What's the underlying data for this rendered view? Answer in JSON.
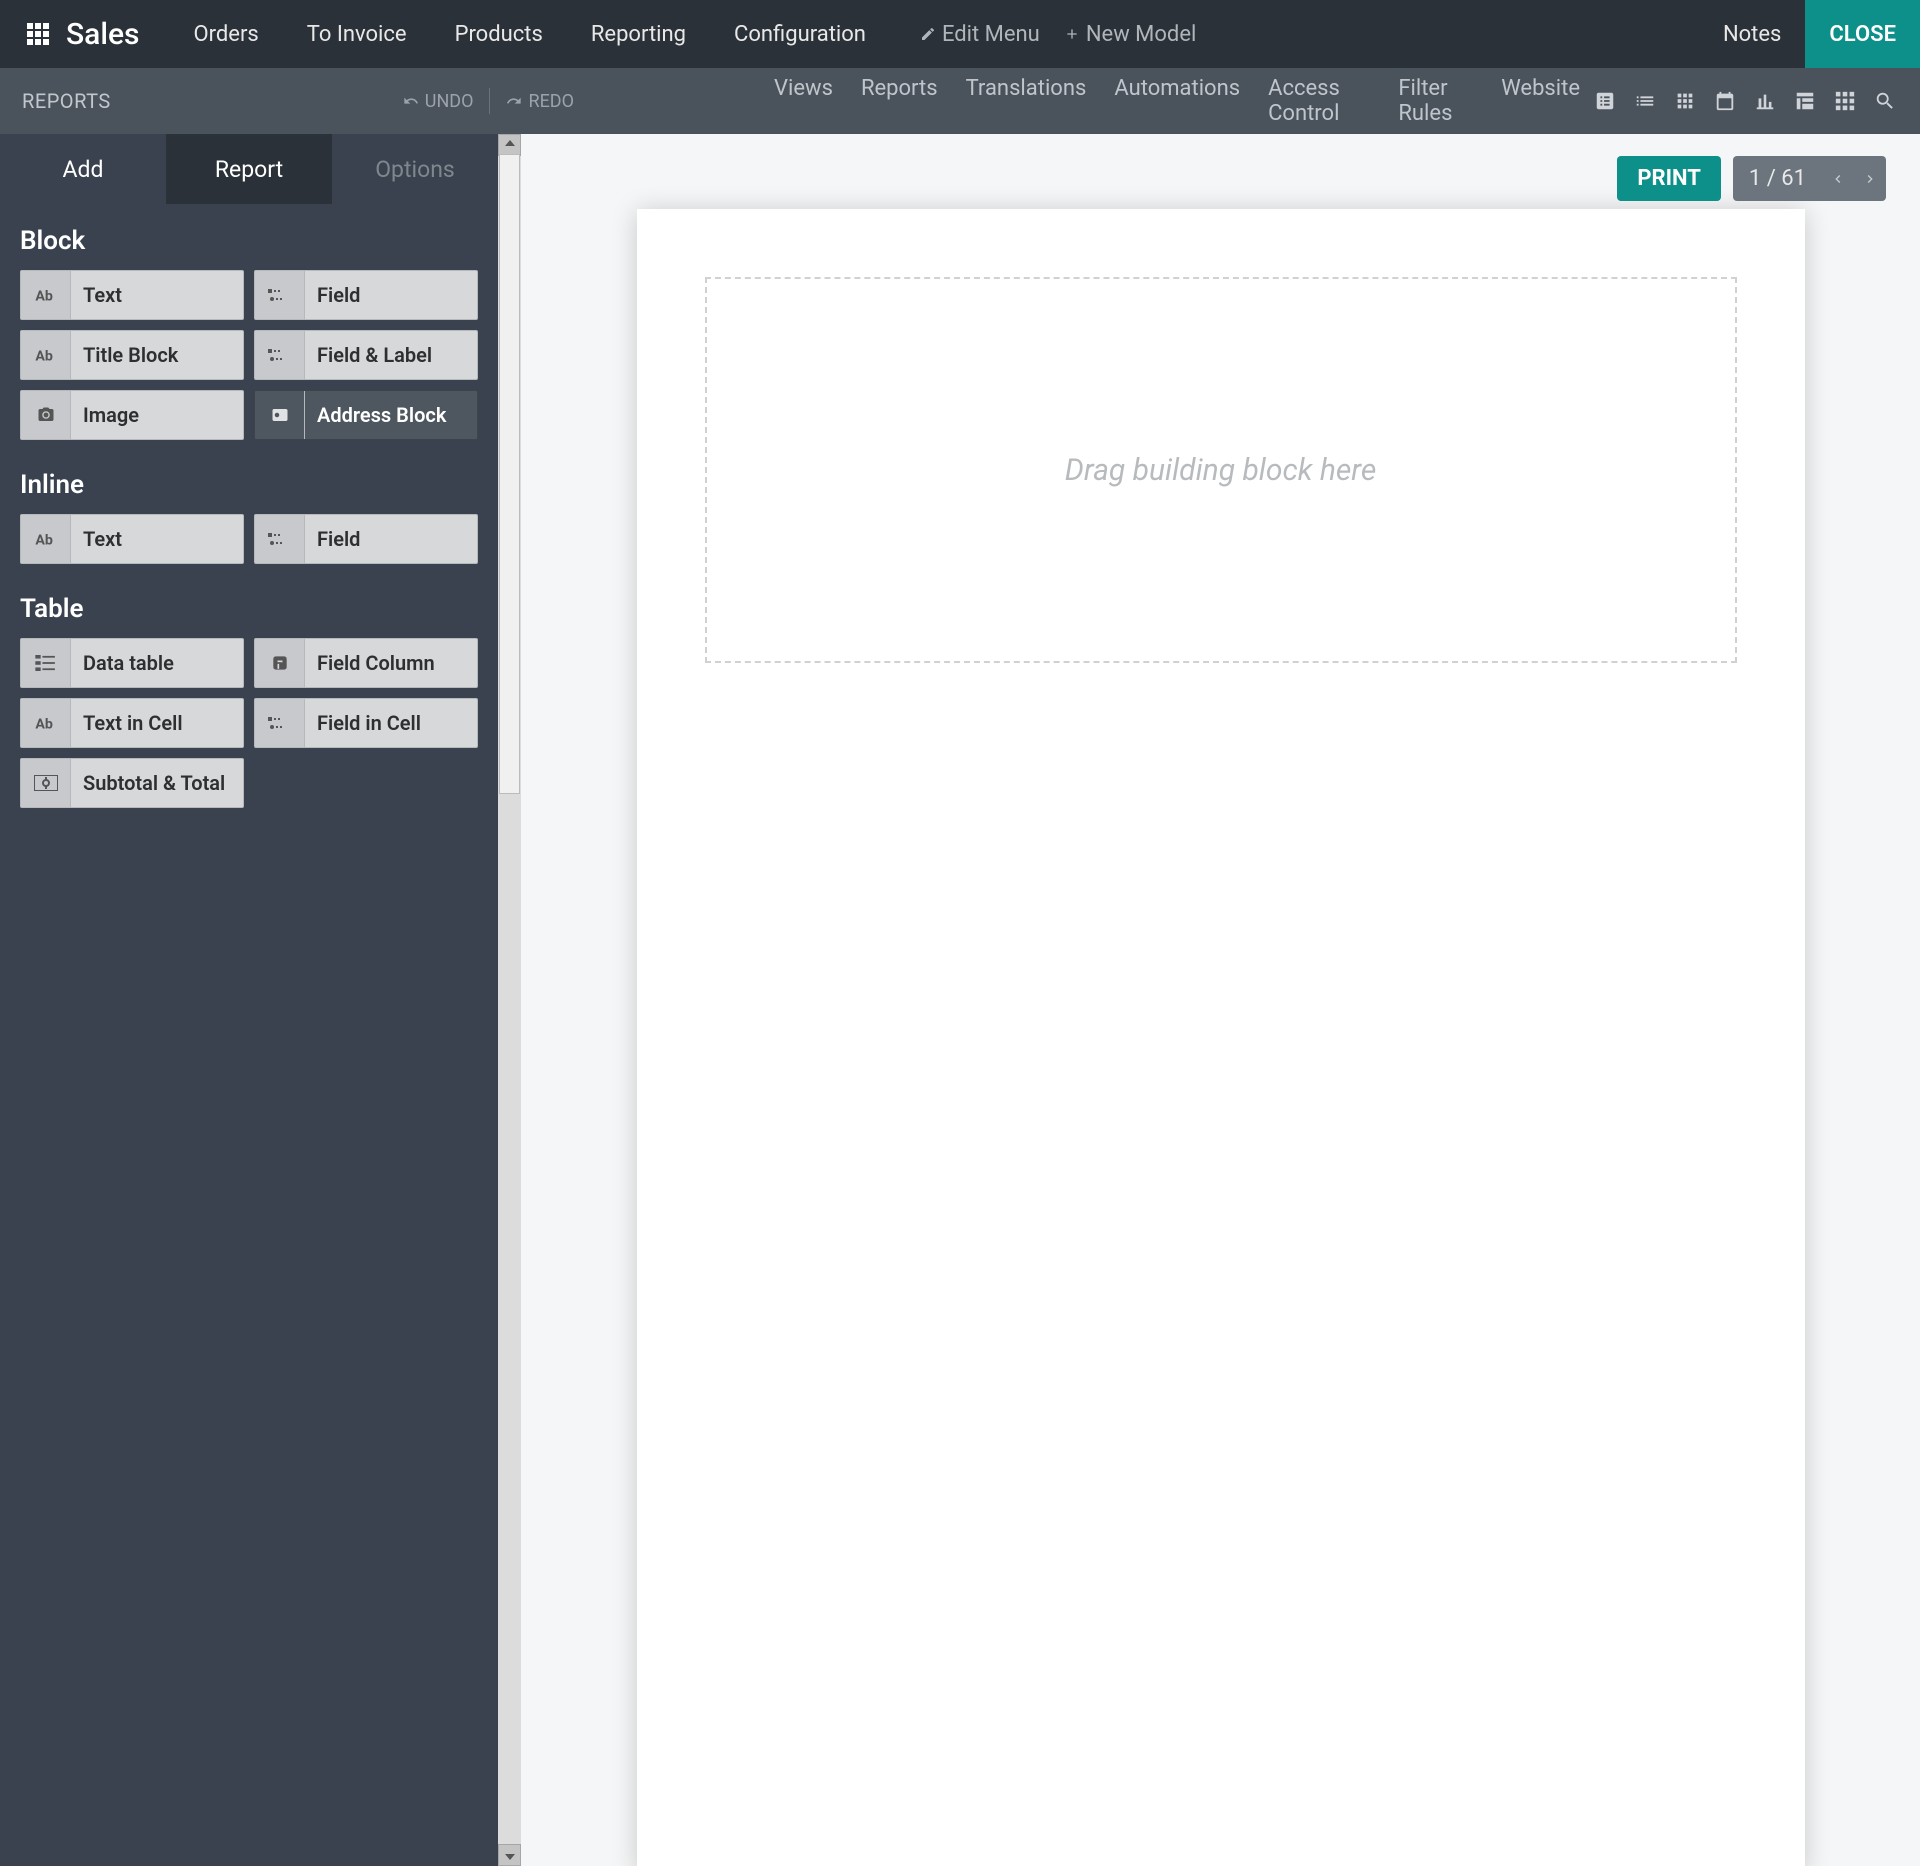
{
  "header": {
    "app_title": "Sales",
    "nav": [
      "Orders",
      "To Invoice",
      "Products",
      "Reporting",
      "Configuration"
    ],
    "edit_menu": "Edit Menu",
    "new_model": "New Model",
    "notes": "Notes",
    "close": "CLOSE"
  },
  "subheader": {
    "left_label": "REPORTS",
    "undo": "UNDO",
    "redo": "REDO",
    "nav": [
      "Views",
      "Reports",
      "Translations",
      "Automations",
      "Access Control",
      "Filter Rules",
      "Website"
    ]
  },
  "sidebar": {
    "tabs": {
      "add": "Add",
      "report": "Report",
      "options": "Options"
    },
    "sections": {
      "block": {
        "title": "Block",
        "items": [
          {
            "icon": "text",
            "label": "Text"
          },
          {
            "icon": "field",
            "label": "Field"
          },
          {
            "icon": "text",
            "label": "Title Block"
          },
          {
            "icon": "field",
            "label": "Field & Label"
          },
          {
            "icon": "image",
            "label": "Image"
          },
          {
            "icon": "address",
            "label": "Address Block",
            "dark": true
          }
        ]
      },
      "inline": {
        "title": "Inline",
        "items": [
          {
            "icon": "text",
            "label": "Text"
          },
          {
            "icon": "field",
            "label": "Field"
          }
        ]
      },
      "table": {
        "title": "Table",
        "items": [
          {
            "icon": "datatable",
            "label": "Data table"
          },
          {
            "icon": "fieldcol",
            "label": "Field Column"
          },
          {
            "icon": "text",
            "label": "Text in Cell"
          },
          {
            "icon": "field",
            "label": "Field in Cell"
          },
          {
            "icon": "subtotal",
            "label": "Subtotal & Total"
          }
        ]
      }
    }
  },
  "canvas": {
    "print": "PRINT",
    "pager_text": "1 / 61",
    "drop_text": "Drag building block here"
  }
}
